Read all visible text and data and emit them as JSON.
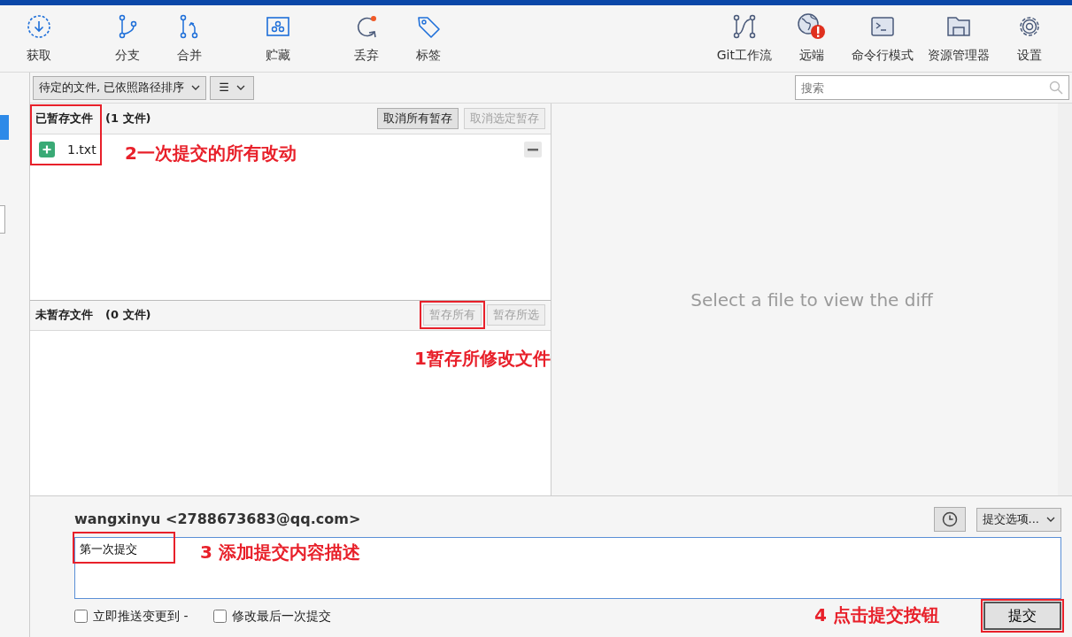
{
  "toolbar": {
    "left_groups": [
      [
        {
          "label": "获取"
        }
      ],
      [
        {
          "label": "分支"
        },
        {
          "label": "合并"
        }
      ],
      [
        {
          "label": "贮藏"
        }
      ],
      [
        {
          "label": "丢弃"
        },
        {
          "label": "标签"
        }
      ]
    ],
    "right": [
      {
        "label": "Git工作流"
      },
      {
        "label": "远端"
      },
      {
        "label": "命令行模式"
      },
      {
        "label": "资源管理器"
      },
      {
        "label": "设置"
      }
    ]
  },
  "filter_bar": {
    "sort_dropdown": "待定的文件, 已依照路径排序",
    "view_button": "☰",
    "search": {
      "placeholder": "搜索"
    }
  },
  "staged": {
    "title": "已暂存文件",
    "count": "(1 文件)",
    "buttons": [
      {
        "label": "取消所有暂存",
        "disabled": false
      },
      {
        "label": "取消选定暂存",
        "disabled": true
      }
    ],
    "files": [
      {
        "name": "1.txt",
        "kind": "added"
      }
    ]
  },
  "unstaged": {
    "title": "未暂存文件",
    "count": "(0 文件)",
    "buttons": [
      {
        "label": "暂存所有",
        "disabled": true
      },
      {
        "label": "暂存所选",
        "disabled": true
      }
    ]
  },
  "diff": {
    "message": "Select a file to view the diff"
  },
  "commit": {
    "author": "wangxinyu <2788673683@qq.com>",
    "options": "提交选项...",
    "message": "第一次提交",
    "checkboxes": [
      {
        "label": "立即推送变更到 -",
        "checked": false
      },
      {
        "label": "修改最后一次提交",
        "checked": false
      }
    ],
    "button": "提交"
  },
  "annotations": [
    {
      "text": "2一次提交的所有改动"
    },
    {
      "text": "1暂存所修改文件"
    },
    {
      "text": "3 添加提交内容描述"
    },
    {
      "text": "4 点击提交按钮"
    }
  ]
}
